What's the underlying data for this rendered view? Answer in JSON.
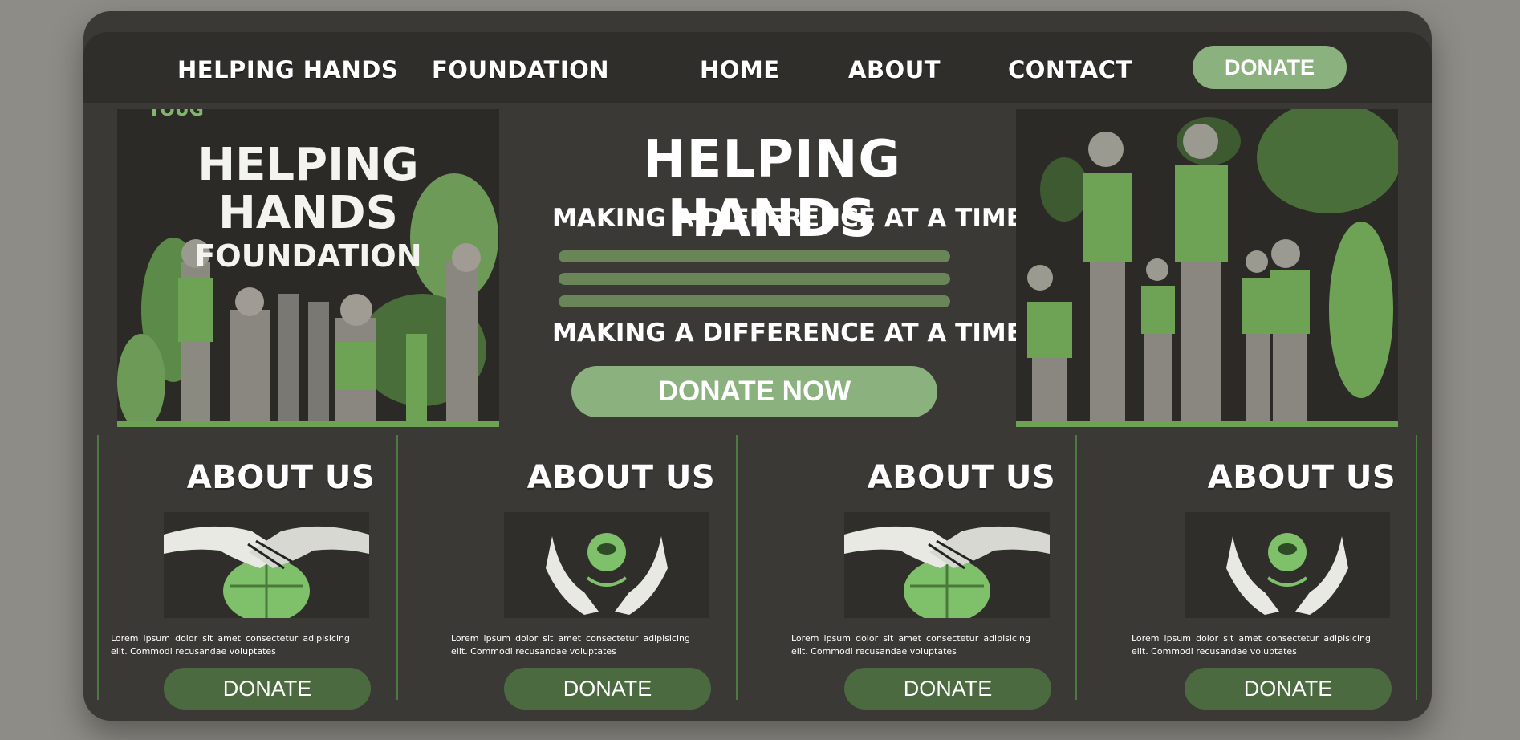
{
  "nav": {
    "brand_part1": "HELPING HANDS",
    "brand_part2": "FOUNDATION",
    "links": [
      "HOME",
      "ABOUT",
      "CONTACT"
    ],
    "donate_label": "DONATE"
  },
  "hero": {
    "left_image": {
      "line1": "HELPING",
      "line2": "HANDS",
      "line3": "FOUNDATION",
      "corner": "YOUG"
    },
    "title": "HELPING HANDS",
    "tagline_top": "MAKING A DIFFERENCE AT A TIME",
    "tagline_bottom": "MAKING A DIFFERENCE AT A TIME",
    "cta_label": "DONATE NOW"
  },
  "features": [
    {
      "title": "ABOUT US",
      "icon": "handshake-globe-icon",
      "text": "Lorem ipsum dolor sit amet consectetur adipisicing elit. Commodi recusandae voluptates",
      "button": "DONATE"
    },
    {
      "title": "ABOUT US",
      "icon": "hands-holding-globe-icon",
      "text": "Lorem ipsum dolor sit amet consectetur adipisicing elit. Commodi recusandae voluptates",
      "button": "DONATE"
    },
    {
      "title": "ABOUT US",
      "icon": "handshake-globe-icon",
      "text": "Lorem ipsum dolor sit amet consectetur adipisicing elit. Commodi recusandae voluptates",
      "button": "DONATE"
    },
    {
      "title": "ABOUT US",
      "icon": "hands-holding-globe-icon",
      "text": "Lorem ipsum dolor sit amet consectetur adipisicing elit. Commodi recusandae voluptates",
      "button": "DONATE"
    }
  ],
  "colors": {
    "page_bg": "#8d8c86",
    "card_bg": "#3a3935",
    "accent_light": "#8bb27e",
    "accent_dark": "#4c6a40",
    "divider": "#4d7a41"
  }
}
